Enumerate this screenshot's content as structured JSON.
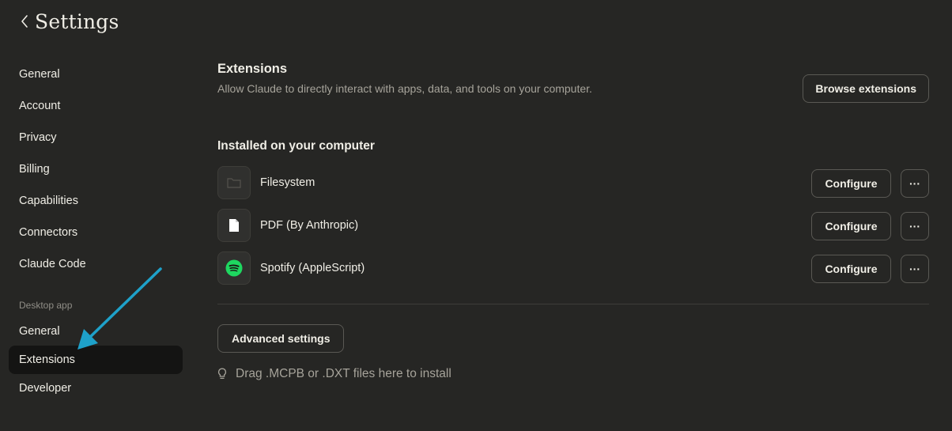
{
  "header": {
    "title": "Settings"
  },
  "sidebar": {
    "items": [
      {
        "label": "General"
      },
      {
        "label": "Account"
      },
      {
        "label": "Privacy"
      },
      {
        "label": "Billing"
      },
      {
        "label": "Capabilities"
      },
      {
        "label": "Connectors"
      },
      {
        "label": "Claude Code"
      }
    ],
    "section_label": "Desktop app",
    "desktop_items": [
      {
        "label": "General"
      },
      {
        "label": "Extensions",
        "active": true
      },
      {
        "label": "Developer"
      }
    ]
  },
  "main": {
    "title": "Extensions",
    "subtitle": "Allow Claude to directly interact with apps, data, and tools on your computer.",
    "browse_label": "Browse extensions",
    "installed_heading": "Installed on your computer",
    "extensions": [
      {
        "name": "Filesystem",
        "icon": "folder-icon",
        "configure_label": "Configure",
        "more_label": "···"
      },
      {
        "name": "PDF (By Anthropic)",
        "icon": "document-icon",
        "configure_label": "Configure",
        "more_label": "···"
      },
      {
        "name": "Spotify (AppleScript)",
        "icon": "spotify-icon",
        "configure_label": "Configure",
        "more_label": "···"
      }
    ],
    "advanced_label": "Advanced settings",
    "drop_hint": "Drag .MCPB or .DXT files here to install"
  },
  "colors": {
    "background": "#262624",
    "active_nav": "#141413",
    "annotation_arrow": "#1ea1c9",
    "spotify": "#1ed760"
  }
}
